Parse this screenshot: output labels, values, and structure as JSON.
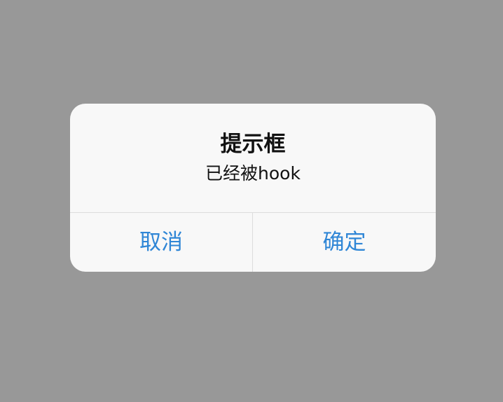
{
  "dialog": {
    "title": "提示框",
    "message": "已经被hook",
    "cancel_label": "取消",
    "confirm_label": "确定"
  },
  "colors": {
    "backdrop": "#989898",
    "dialog_background": "#f8f8f8",
    "button_text": "#2f86d6",
    "divider": "#dcdcdc"
  }
}
